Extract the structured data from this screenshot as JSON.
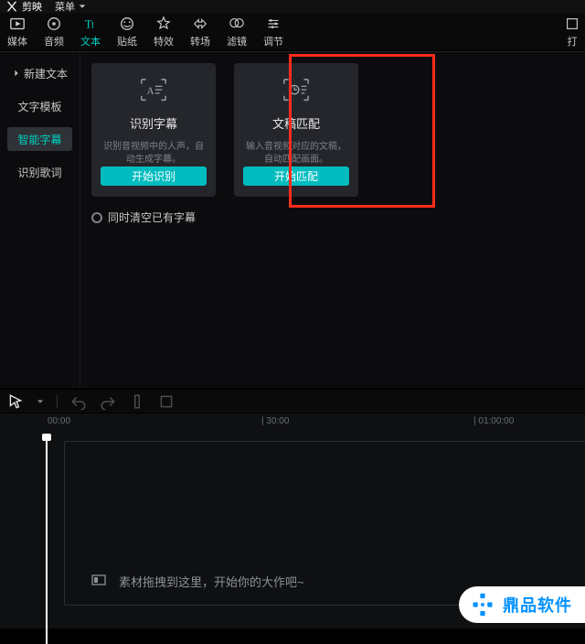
{
  "titlebar": {
    "app_name": "剪映",
    "menu_label": "菜单"
  },
  "tabs": [
    {
      "key": "media",
      "label": "媒体"
    },
    {
      "key": "audio",
      "label": "音频"
    },
    {
      "key": "text",
      "label": "文本"
    },
    {
      "key": "sticker",
      "label": "贴纸"
    },
    {
      "key": "effect",
      "label": "特效"
    },
    {
      "key": "trans",
      "label": "转场"
    },
    {
      "key": "filter",
      "label": "滤镜"
    },
    {
      "key": "adjust",
      "label": "调节"
    },
    {
      "key": "more",
      "label": "打"
    }
  ],
  "active_tab": "text",
  "sidebar": {
    "items": [
      {
        "key": "new_text",
        "label": "新建文本"
      },
      {
        "key": "text_tpl",
        "label": "文字模板"
      },
      {
        "key": "smart_sub",
        "label": "智能字幕"
      },
      {
        "key": "lyric",
        "label": "识别歌词"
      }
    ],
    "active": "smart_sub"
  },
  "cards": [
    {
      "key": "recognize",
      "title": "识别字幕",
      "desc": "识别音视频中的人声，自动生成字幕。",
      "button": "开始识别"
    },
    {
      "key": "match",
      "title": "文稿匹配",
      "desc": "输入音视频对应的文稿，自动匹配画面。",
      "button": "开始匹配"
    }
  ],
  "checkbox_label": "同时清空已有字幕",
  "ruler": {
    "marks": [
      "00:00",
      "| 30:00",
      "| 01:00:00"
    ],
    "positions": [
      52,
      286,
      518
    ]
  },
  "drop_hint": "素材拖拽到这里，开始你的大作吧~",
  "watermark": "鼎品软件",
  "colors": {
    "accent": "#00bcbf",
    "highlight": "#ff2b1c"
  }
}
